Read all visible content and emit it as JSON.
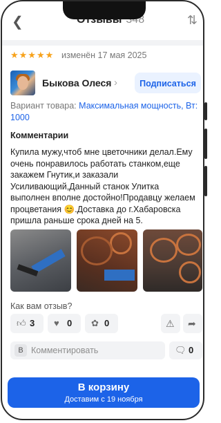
{
  "header": {
    "title": "Отзывы",
    "count": "348"
  },
  "review": {
    "stars": "★★★★★",
    "rating": 5,
    "edited": "изменён 17 мая 2025",
    "author": "Быкова Олеся",
    "subscribe_label": "Подписаться",
    "variant_label": "Вариант товара:",
    "variant_value": "Максимальная мощность, Вт: 1000",
    "comments_title": "Комментарии",
    "comments_text": "Купила мужу,чтоб мне цветочники делал.Ему очень понравилось работать станком,еще закажем Гнутик,и заказали Усиливающий,Данный станок Улитка выполнен вполне достойно!Продавцу желаем процветания 😊.Доставка до г.Хабаровска пришла раньше срока дней на 5."
  },
  "feedback": {
    "question": "Как вам отзыв?",
    "likes": "3",
    "dislikes": "0",
    "claps": "0"
  },
  "comment": {
    "avatar_letter": "В",
    "placeholder": "Комментировать",
    "count": "0"
  },
  "cart": {
    "label": "В корзину",
    "delivery": "Доставим с 19 ноября"
  },
  "icons": {
    "back": "chevron-left-icon",
    "sort": "sort-arrows-icon",
    "like": "thumbs-up-icon",
    "dislike": "heart-icon",
    "clap": "clap-icon",
    "report": "warning-icon",
    "share": "share-arrow-icon",
    "comment": "comment-bubble-icon"
  },
  "colors": {
    "accent": "#1c63e8",
    "stars": "#f7a21b"
  }
}
